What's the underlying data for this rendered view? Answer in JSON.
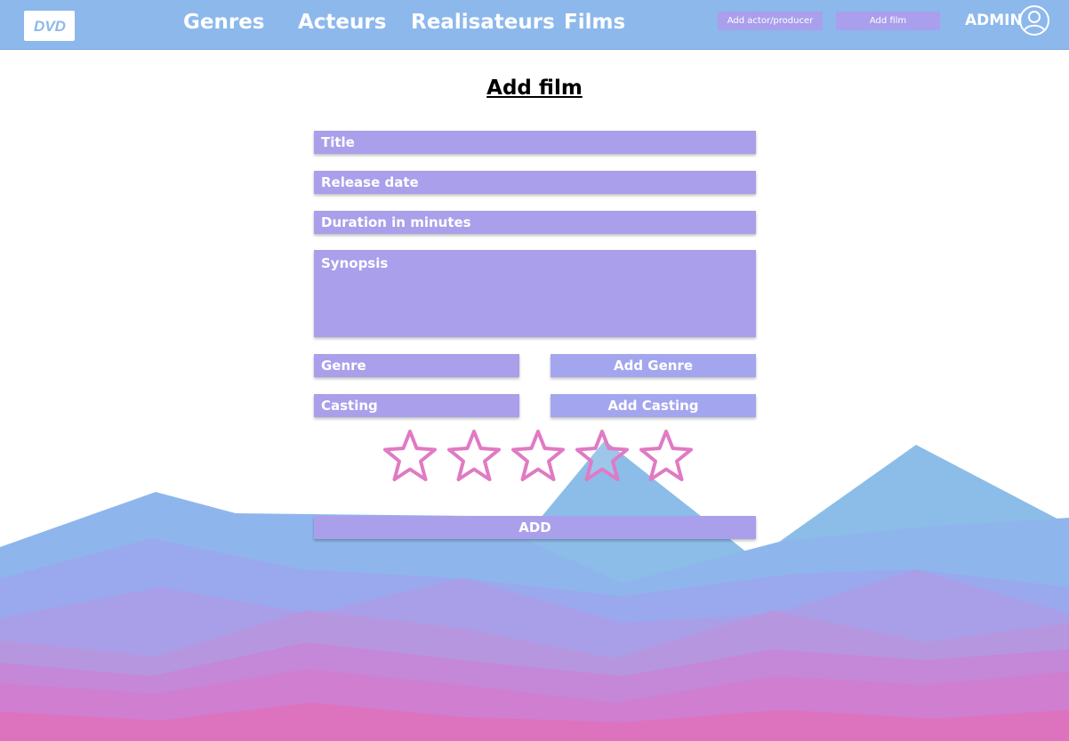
{
  "header": {
    "logo_text": "DVD",
    "nav": {
      "genres": "Genres",
      "acteurs": "Acteurs",
      "realisateurs": "Realisateurs",
      "films": "Films"
    },
    "add_actor_button": "Add actor/producer",
    "add_film_button": "Add film",
    "admin_label": "ADMIN",
    "user_icon": "user-circle-icon"
  },
  "page": {
    "title": "Add film"
  },
  "form": {
    "title_placeholder": "Title",
    "release_date_placeholder": "Release date",
    "duration_placeholder": "Duration in minutes",
    "synopsis_placeholder": "Synopsis",
    "genre_placeholder": "Genre",
    "add_genre_button": "Add Genre",
    "casting_placeholder": "Casting",
    "add_casting_button": "Add Casting",
    "rating": {
      "max_stars": 5,
      "selected": 0,
      "star_icon": "star-outline-icon"
    },
    "submit_button": "ADD"
  },
  "colors": {
    "header": "#8cb8ec",
    "field": "#a99fea",
    "side_button": "#a3a6ee",
    "star_outline": "#e07ac4",
    "mountain_blue": "#8cbde8",
    "mountain_pink": "#e07ac4"
  }
}
